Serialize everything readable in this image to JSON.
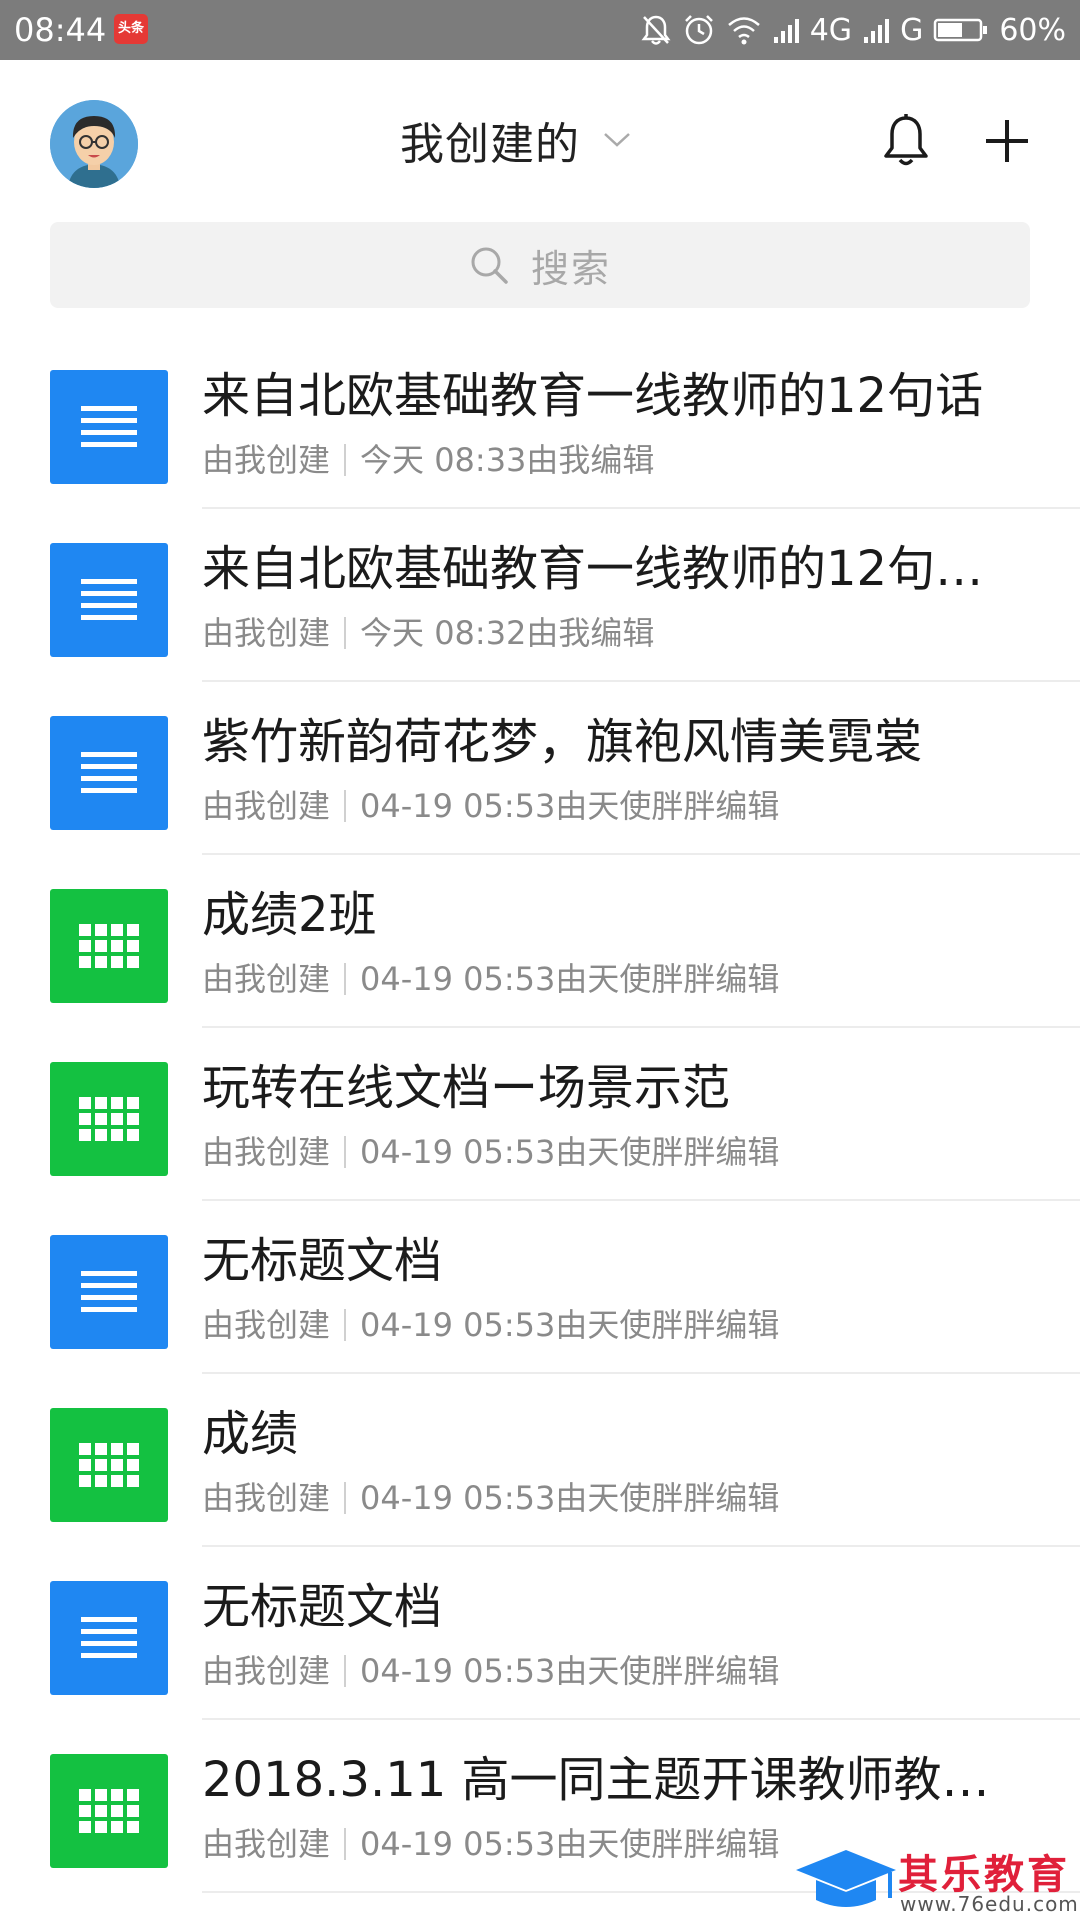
{
  "status_bar": {
    "time": "08:44",
    "app_badge": "头条",
    "network_1": "4G",
    "network_2": "G",
    "battery": "60%"
  },
  "header": {
    "title": "我创建的",
    "icons": [
      "avatar",
      "chevron-down-icon",
      "bell-icon",
      "plus-icon"
    ]
  },
  "search": {
    "placeholder": "搜索"
  },
  "files": [
    {
      "type": "doc",
      "name": "来自北欧基础教育一线教师的12句话",
      "creator": "由我创建",
      "edited": "今天 08:33由我编辑"
    },
    {
      "type": "doc",
      "name": "来自北欧基础教育一线教师的12句…",
      "creator": "由我创建",
      "edited": "今天 08:32由我编辑"
    },
    {
      "type": "doc",
      "name": "紫竹新韵荷花梦，旗袍风情美霓裳",
      "creator": "由我创建",
      "edited": "04-19 05:53由天使胖胖编辑"
    },
    {
      "type": "sheet",
      "name": "成绩2班",
      "creator": "由我创建",
      "edited": "04-19 05:53由天使胖胖编辑"
    },
    {
      "type": "sheet",
      "name": "玩转在线文档ー场景示范",
      "creator": "由我创建",
      "edited": "04-19 05:53由天使胖胖编辑"
    },
    {
      "type": "doc",
      "name": "无标题文档",
      "creator": "由我创建",
      "edited": "04-19 05:53由天使胖胖编辑"
    },
    {
      "type": "sheet",
      "name": "成绩",
      "creator": "由我创建",
      "edited": "04-19 05:53由天使胖胖编辑"
    },
    {
      "type": "doc",
      "name": "无标题文档",
      "creator": "由我创建",
      "edited": "04-19 05:53由天使胖胖编辑"
    },
    {
      "type": "sheet",
      "name": "2018.3.11 高一同主题开课教师教…",
      "creator": "由我创建",
      "edited": "04-19 05:53由天使胖胖编辑"
    }
  ],
  "watermark": {
    "text": "其乐教育",
    "url": "www.76edu.com"
  },
  "colors": {
    "doc": "#1f87f2",
    "sheet": "#14c141",
    "status_bar": "#7c7c7c"
  }
}
